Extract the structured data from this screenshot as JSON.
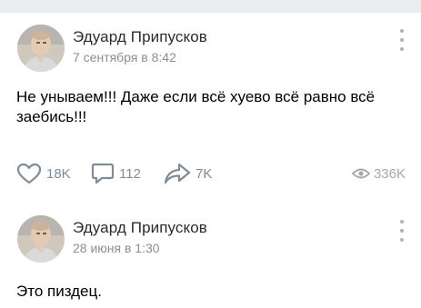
{
  "posts": [
    {
      "author": "Эдуард Припусков",
      "date": "7 сентября в 8:42",
      "text": "Не унываем!!! Даже если всё хуево всё равно всё заебись!!!",
      "likes": "18K",
      "comments": "112",
      "shares": "7K",
      "views": "336K"
    },
    {
      "author": "Эдуард Припусков",
      "date": "28 июня в 1:30",
      "text": "Это пиздец."
    }
  ],
  "icons": {
    "like": "heart-icon",
    "comment": "comment-icon",
    "share": "share-arrow-icon",
    "views": "eye-icon",
    "menu": "more-vertical-icon"
  },
  "colors": {
    "author": "#2b2b2b",
    "secondary_text": "#8a8d91",
    "action_icon": "#818c99",
    "background": "#ffffff",
    "separator": "#ebedf0"
  }
}
